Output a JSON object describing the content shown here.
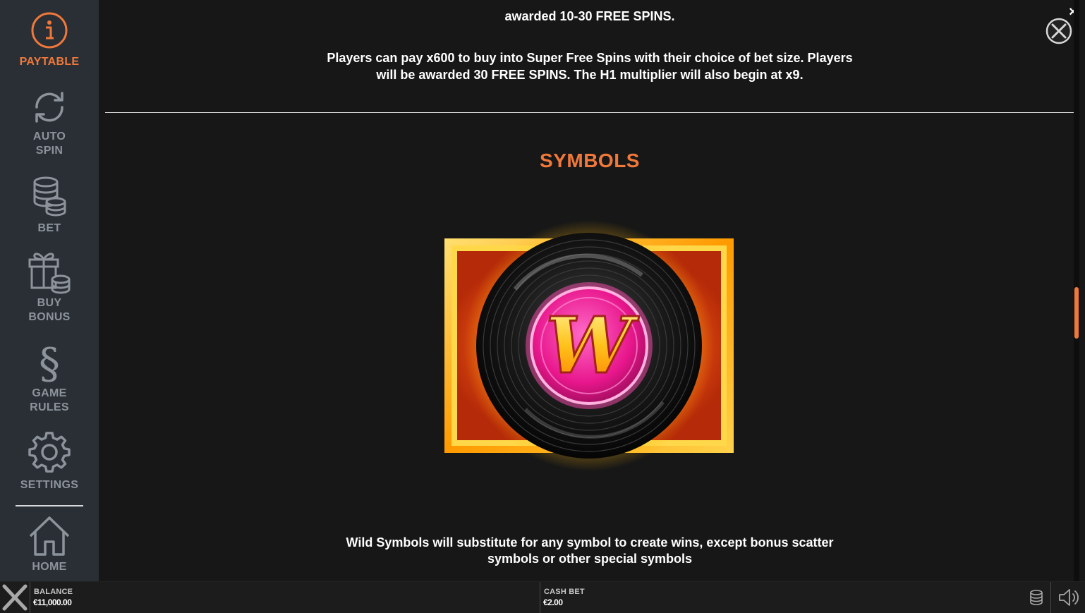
{
  "sidebar": {
    "items": [
      {
        "id": "paytable",
        "label": "PAYTABLE",
        "icon": "info-icon",
        "active": true
      },
      {
        "id": "autospin",
        "label_lines": [
          "AUTO",
          "SPIN"
        ],
        "icon": "refresh-icon"
      },
      {
        "id": "bet",
        "label": "BET",
        "icon": "coins-stack-icon"
      },
      {
        "id": "buybonus",
        "label_lines": [
          "BUY",
          "BONUS"
        ],
        "icon": "gift-icon"
      },
      {
        "id": "gamerules",
        "label_lines": [
          "GAME",
          "RULES"
        ],
        "icon": "section-icon"
      },
      {
        "id": "settings",
        "label": "SETTINGS",
        "icon": "gear-icon"
      },
      {
        "id": "home",
        "label": "HOME",
        "icon": "home-icon"
      }
    ]
  },
  "content": {
    "top_line": "awarded 10-30 FREE SPINS.",
    "super_spins_line1": "Players can pay x600 to buy into Super Free Spins with their choice of bet size. Players",
    "super_spins_line2": "will be awarded 30 FREE SPINS. The H1 multiplier will also begin at x9.",
    "section_title": "SYMBOLS",
    "wild_symbol_letter": "W",
    "wild_desc_line1": "Wild Symbols will substitute for any symbol to create wins, except bonus scatter",
    "wild_desc_line2": "symbols or other special symbols"
  },
  "bottom_bar": {
    "balance_label": "BALANCE",
    "balance_value": "€11,000.00",
    "cash_bet_label": "CASH BET",
    "cash_bet_value": "€2.00"
  },
  "colors": {
    "accent": "#f0783a",
    "sidebar_bg": "#2a2f35",
    "main_bg": "#171717",
    "inactive_icon": "#8c939b"
  }
}
